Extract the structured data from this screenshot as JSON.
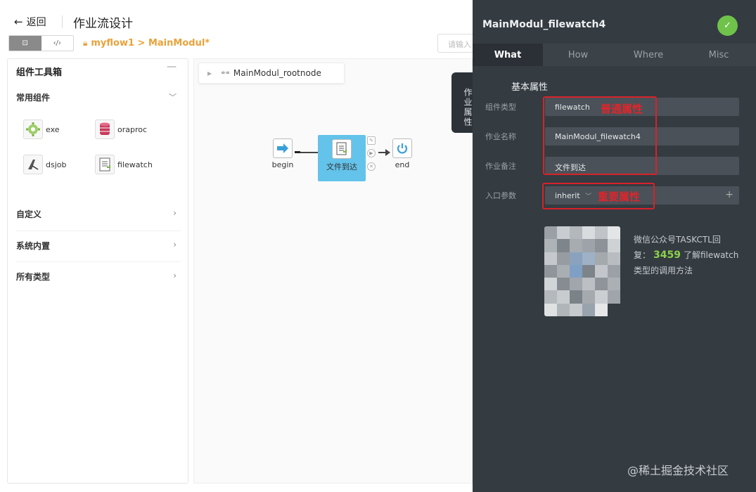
{
  "header": {
    "back_label": "返回",
    "page_title": "作业流设计",
    "view_icons": [
      "design-view-icon",
      "code-view-icon"
    ],
    "view_design_glyph": "⊡",
    "view_code_glyph": "‹/›",
    "breadcrumb": "myflow1 > MainModul*",
    "search_placeholder": "请输入"
  },
  "toolbox": {
    "title": "组件工具箱",
    "collapse_glyph": "—",
    "common_label": "常用组件",
    "components": [
      {
        "label": "exe",
        "icon": "gear-icon"
      },
      {
        "label": "oraproc",
        "icon": "database-icon"
      },
      {
        "label": "dsjob",
        "icon": "datastage-icon"
      },
      {
        "label": "filewatch",
        "icon": "document-icon"
      }
    ],
    "categories": [
      "自定义",
      "系统内置",
      "所有类型"
    ]
  },
  "canvas": {
    "root_node": "MainModul_rootnode",
    "nodes": {
      "begin": "begin",
      "task": "文件到达",
      "end": "end"
    }
  },
  "side_tab": "作业属性",
  "panel": {
    "title": "MainModul_filewatch4",
    "tabs": [
      "What",
      "How",
      "Where",
      "Misc"
    ],
    "active_tab": "What",
    "section_title": "基本属性",
    "fields": {
      "type_label": "组件类型",
      "type_value": "filewatch",
      "name_label": "作业名称",
      "name_value": "MainModul_filewatch4",
      "note_label": "作业备注",
      "note_value": "文件到达",
      "param_label": "入口参数",
      "param_value": "inherit"
    },
    "annotations": {
      "basic": "普通属性",
      "special": "重要属性"
    },
    "info": {
      "line1": "微信公众号TASKCTL回",
      "line2_prefix": "复：",
      "code": "3459",
      "line2_suffix": "了解filewatch",
      "line3": "类型的调用方法"
    },
    "watermark": "@稀土掘金技术社区",
    "colors": {
      "accent_green": "#6fc34a",
      "highlight": "#8bd04a",
      "annotation_red": "#e0252b",
      "task_blue": "#63c3ea"
    }
  }
}
